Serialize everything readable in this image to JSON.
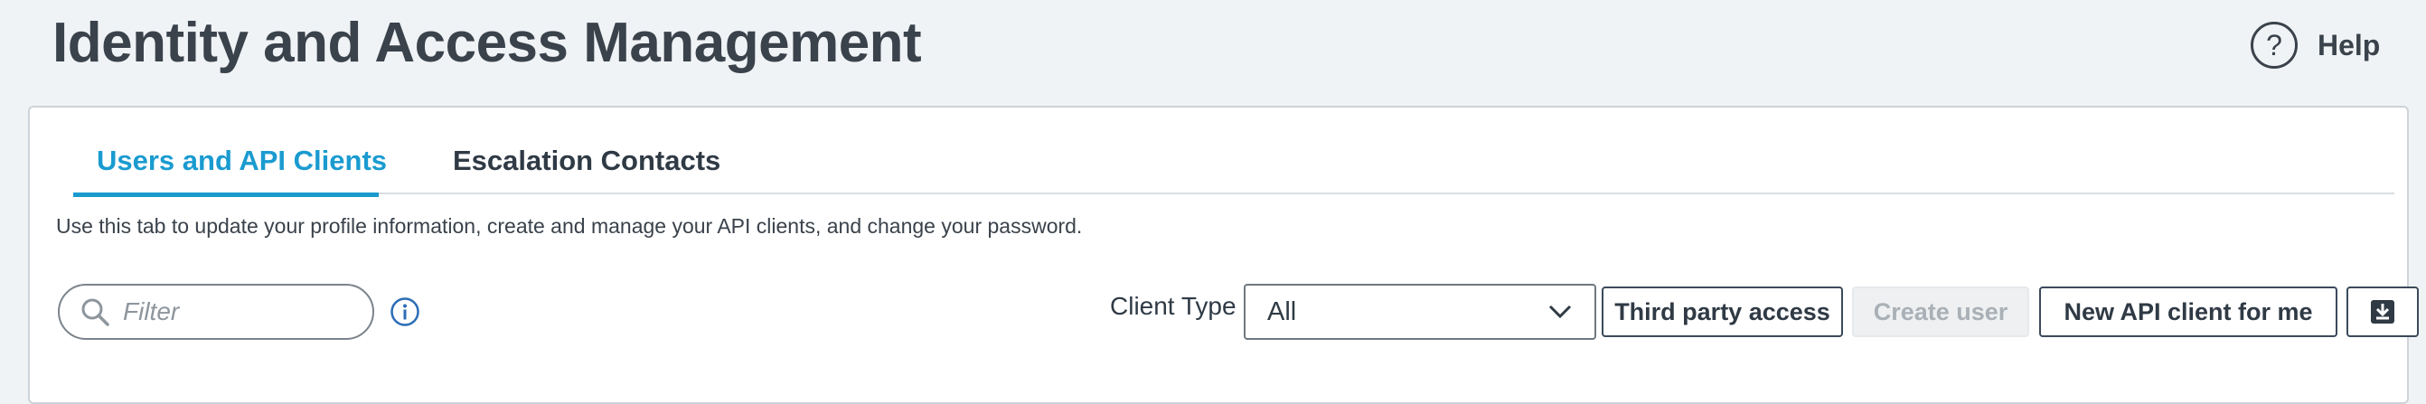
{
  "header": {
    "title": "Identity and Access Management",
    "help_label": "Help",
    "help_icon": "question-circle-icon"
  },
  "tabs": [
    {
      "label": "Users and API Clients",
      "active": true
    },
    {
      "label": "Escalation Contacts",
      "active": false
    }
  ],
  "description": "Use this tab to update your profile information, create and manage your API clients, and change your password.",
  "toolbar": {
    "filter_placeholder": "Filter",
    "filter_value": "",
    "client_type_label": "Client Type",
    "client_type_value": "All",
    "third_party_label": "Third party access",
    "create_user_label": "Create user",
    "create_user_disabled": true,
    "new_api_client_label": "New API client for me",
    "download_icon": "download-icon"
  },
  "colors": {
    "accent": "#1a9bd0",
    "background": "#f0f3f6",
    "text": "#2f3a45",
    "info_icon": "#2a6db5"
  }
}
